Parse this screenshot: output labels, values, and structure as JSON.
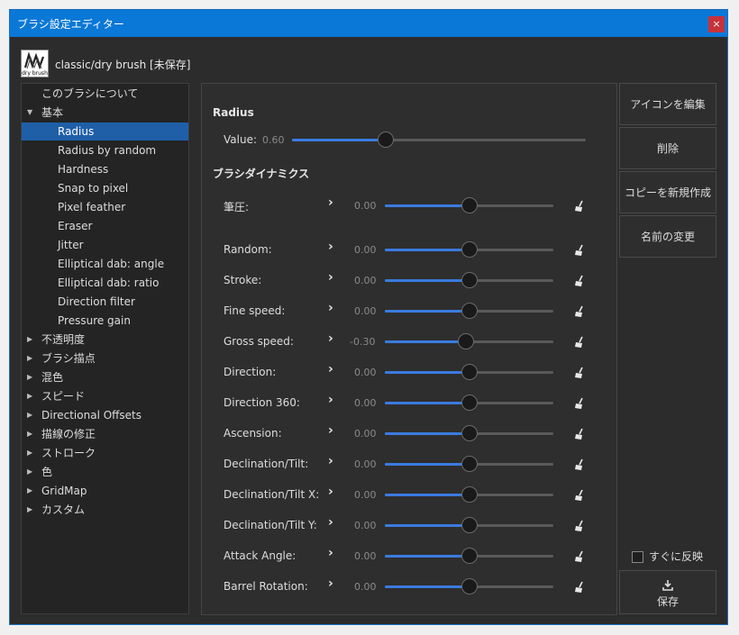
{
  "window": {
    "title": "ブラシ設定エディター",
    "close_label": "×"
  },
  "brush": {
    "icon_caption": "dry brush",
    "name": "classic/dry brush [未保存]"
  },
  "tree": [
    {
      "label": "このブラシについて",
      "level": 0,
      "expander": "none",
      "selected": false
    },
    {
      "label": "基本",
      "level": 0,
      "expander": "open",
      "selected": false
    },
    {
      "label": "Radius",
      "level": 1,
      "expander": "none",
      "selected": true
    },
    {
      "label": "Radius by random",
      "level": 1,
      "expander": "none",
      "selected": false
    },
    {
      "label": "Hardness",
      "level": 1,
      "expander": "none",
      "selected": false
    },
    {
      "label": "Snap to pixel",
      "level": 1,
      "expander": "none",
      "selected": false
    },
    {
      "label": "Pixel feather",
      "level": 1,
      "expander": "none",
      "selected": false
    },
    {
      "label": "Eraser",
      "level": 1,
      "expander": "none",
      "selected": false
    },
    {
      "label": "Jitter",
      "level": 1,
      "expander": "none",
      "selected": false
    },
    {
      "label": "Elliptical dab: angle",
      "level": 1,
      "expander": "none",
      "selected": false
    },
    {
      "label": "Elliptical dab: ratio",
      "level": 1,
      "expander": "none",
      "selected": false
    },
    {
      "label": "Direction filter",
      "level": 1,
      "expander": "none",
      "selected": false
    },
    {
      "label": "Pressure gain",
      "level": 1,
      "expander": "none",
      "selected": false
    },
    {
      "label": "不透明度",
      "level": 0,
      "expander": "closed",
      "selected": false
    },
    {
      "label": "ブラシ描点",
      "level": 0,
      "expander": "closed",
      "selected": false
    },
    {
      "label": "混色",
      "level": 0,
      "expander": "closed",
      "selected": false
    },
    {
      "label": "スピード",
      "level": 0,
      "expander": "closed",
      "selected": false
    },
    {
      "label": "Directional Offsets",
      "level": 0,
      "expander": "closed",
      "selected": false
    },
    {
      "label": "描線の修正",
      "level": 0,
      "expander": "closed",
      "selected": false
    },
    {
      "label": "ストローク",
      "level": 0,
      "expander": "closed",
      "selected": false
    },
    {
      "label": "色",
      "level": 0,
      "expander": "closed",
      "selected": false
    },
    {
      "label": "GridMap",
      "level": 0,
      "expander": "closed",
      "selected": false
    },
    {
      "label": "カスタム",
      "level": 0,
      "expander": "closed",
      "selected": false
    }
  ],
  "radius_section": {
    "title": "Radius",
    "value_label": "Value:",
    "value_text": "0.60",
    "value_fraction": 0.32
  },
  "dynamics_section": {
    "title": "ブラシダイナミクス",
    "rows": [
      {
        "label": "筆圧:",
        "value": "0.00",
        "fraction": 0.5
      },
      {
        "label": "Random:",
        "value": "0.00",
        "fraction": 0.5
      },
      {
        "label": "Stroke:",
        "value": "0.00",
        "fraction": 0.5
      },
      {
        "label": "Fine speed:",
        "value": "0.00",
        "fraction": 0.5
      },
      {
        "label": "Gross speed:",
        "value": "-0.30",
        "fraction": 0.48
      },
      {
        "label": "Direction:",
        "value": "0.00",
        "fraction": 0.5
      },
      {
        "label": "Direction 360:",
        "value": "0.00",
        "fraction": 0.5
      },
      {
        "label": "Ascension:",
        "value": "0.00",
        "fraction": 0.5
      },
      {
        "label": "Declination/Tilt:",
        "value": "0.00",
        "fraction": 0.5
      },
      {
        "label": "Declination/Tilt X:",
        "value": "0.00",
        "fraction": 0.5
      },
      {
        "label": "Declination/Tilt Y:",
        "value": "0.00",
        "fraction": 0.5
      },
      {
        "label": "Attack Angle:",
        "value": "0.00",
        "fraction": 0.5
      },
      {
        "label": "Barrel Rotation:",
        "value": "0.00",
        "fraction": 0.5
      }
    ]
  },
  "actions": {
    "edit_icon": "アイコンを編集",
    "delete": "削除",
    "copy_new": "コピーを新規作成",
    "rename": "名前の変更",
    "instant_apply": "すぐに反映",
    "save": "保存"
  },
  "colors": {
    "accent": "#0a78d7",
    "selection": "#1f5fa8",
    "slider_fill": "#3a7be0"
  }
}
